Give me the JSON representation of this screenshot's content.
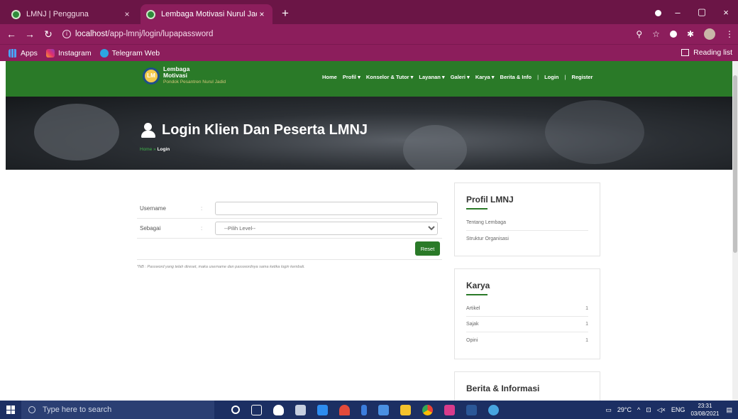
{
  "browser": {
    "tabs": [
      {
        "title": "LMNJ | Pengguna",
        "close": "×"
      },
      {
        "title": "Lembaga Motivasi Nurul Jadid - ",
        "close": "×"
      }
    ],
    "new_tab": "+",
    "window_controls": {
      "minimize": "–",
      "maximize": "▢",
      "close": "×"
    },
    "address": {
      "host": "localhost",
      "path": "/app-lmnj/login/lupapassword"
    },
    "bookmarks": [
      "Apps",
      "Instagram",
      "Telegram Web"
    ],
    "reading_list": "Reading list"
  },
  "site": {
    "logo": {
      "line1": "Lembaga",
      "line2": "Motivasi",
      "tagline": "Pondok Pesantren Nurul Jadid"
    },
    "menu": [
      "Home",
      "Profil ▾",
      "Konselor & Tutor ▾",
      "Layanan ▾",
      "Galeri ▾",
      "Karya ▾",
      "Berita & Info",
      "|",
      "Login",
      "|",
      "Register"
    ],
    "hero": {
      "title": "Login Klien Dan Peserta LMNJ",
      "crumb_home": "Home",
      "crumb_sep": " » ",
      "crumb_current": "Login"
    }
  },
  "form": {
    "username_label": "Username",
    "colon": ":",
    "sebagai_label": "Sebagai",
    "level_selected": "--Pilih Level--",
    "reset_label": "Reset",
    "note": "*NB : Password yang telah direset, maka username dan passwordnya sama ketika login kembali."
  },
  "sidebar": {
    "profil": {
      "title": "Profil LMNJ",
      "items": [
        "Tentang Lembaga",
        "Struktur Organisasi"
      ]
    },
    "karya": {
      "title": "Karya",
      "items": [
        {
          "label": "Artikel",
          "count": "1"
        },
        {
          "label": "Sajak",
          "count": "1"
        },
        {
          "label": "Opini",
          "count": "1"
        }
      ]
    },
    "berita": {
      "title": "Berita & Informasi"
    }
  },
  "taskbar": {
    "search_placeholder": "Type here to search",
    "weather": "29°C",
    "lang": "ENG",
    "time": "23:31",
    "date": "03/08/2021"
  },
  "colors": {
    "browser": "#8c1e5c",
    "site_green": "#2a7a28",
    "taskbar": "#1c2f63"
  }
}
